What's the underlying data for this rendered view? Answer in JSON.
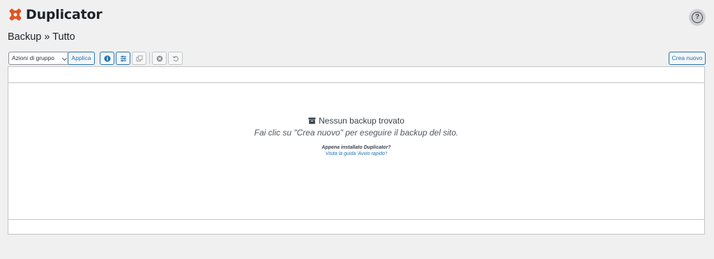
{
  "header": {
    "logo_text": "Duplicator",
    "help_icon": "help-circle-icon",
    "brand_color": "#e3531f"
  },
  "breadcrumb": "Backup » Tutto",
  "toolbar": {
    "bulk_actions": "Azioni di gruppo",
    "apply": "Applica",
    "icons": [
      "info-icon",
      "filter-icon",
      "copy-icon",
      "close-circle-icon",
      "undo-icon"
    ],
    "create_new": "Crea nuovo"
  },
  "empty_state": {
    "icon": "archive-icon",
    "title": "Nessun backup trovato",
    "subtitle": "Fai clic su \"Crea nuovo\" per eseguire il backup del sito.",
    "question": "Appena installato Duplicator?",
    "link": "Visita la guida 'Avvio rapido'!"
  },
  "colors": {
    "accent": "#2271b1",
    "background": "#f0f0f1"
  }
}
